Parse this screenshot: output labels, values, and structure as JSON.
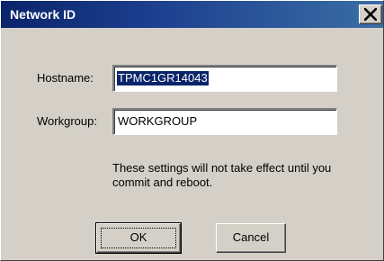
{
  "window": {
    "title": "Network ID"
  },
  "icons": {
    "close": "close-icon"
  },
  "form": {
    "hostname_label": "Hostname:",
    "hostname_value": "TPMC1GR14043",
    "workgroup_label": "Workgroup:",
    "workgroup_value": "WORKGROUP"
  },
  "note": "These settings will not take effect until you commit and reboot.",
  "buttons": {
    "ok_label": "OK",
    "cancel_label": "Cancel"
  },
  "colors": {
    "titlebar": "#0a246a",
    "face": "#d4d0c8",
    "selection": "#0a246a"
  }
}
